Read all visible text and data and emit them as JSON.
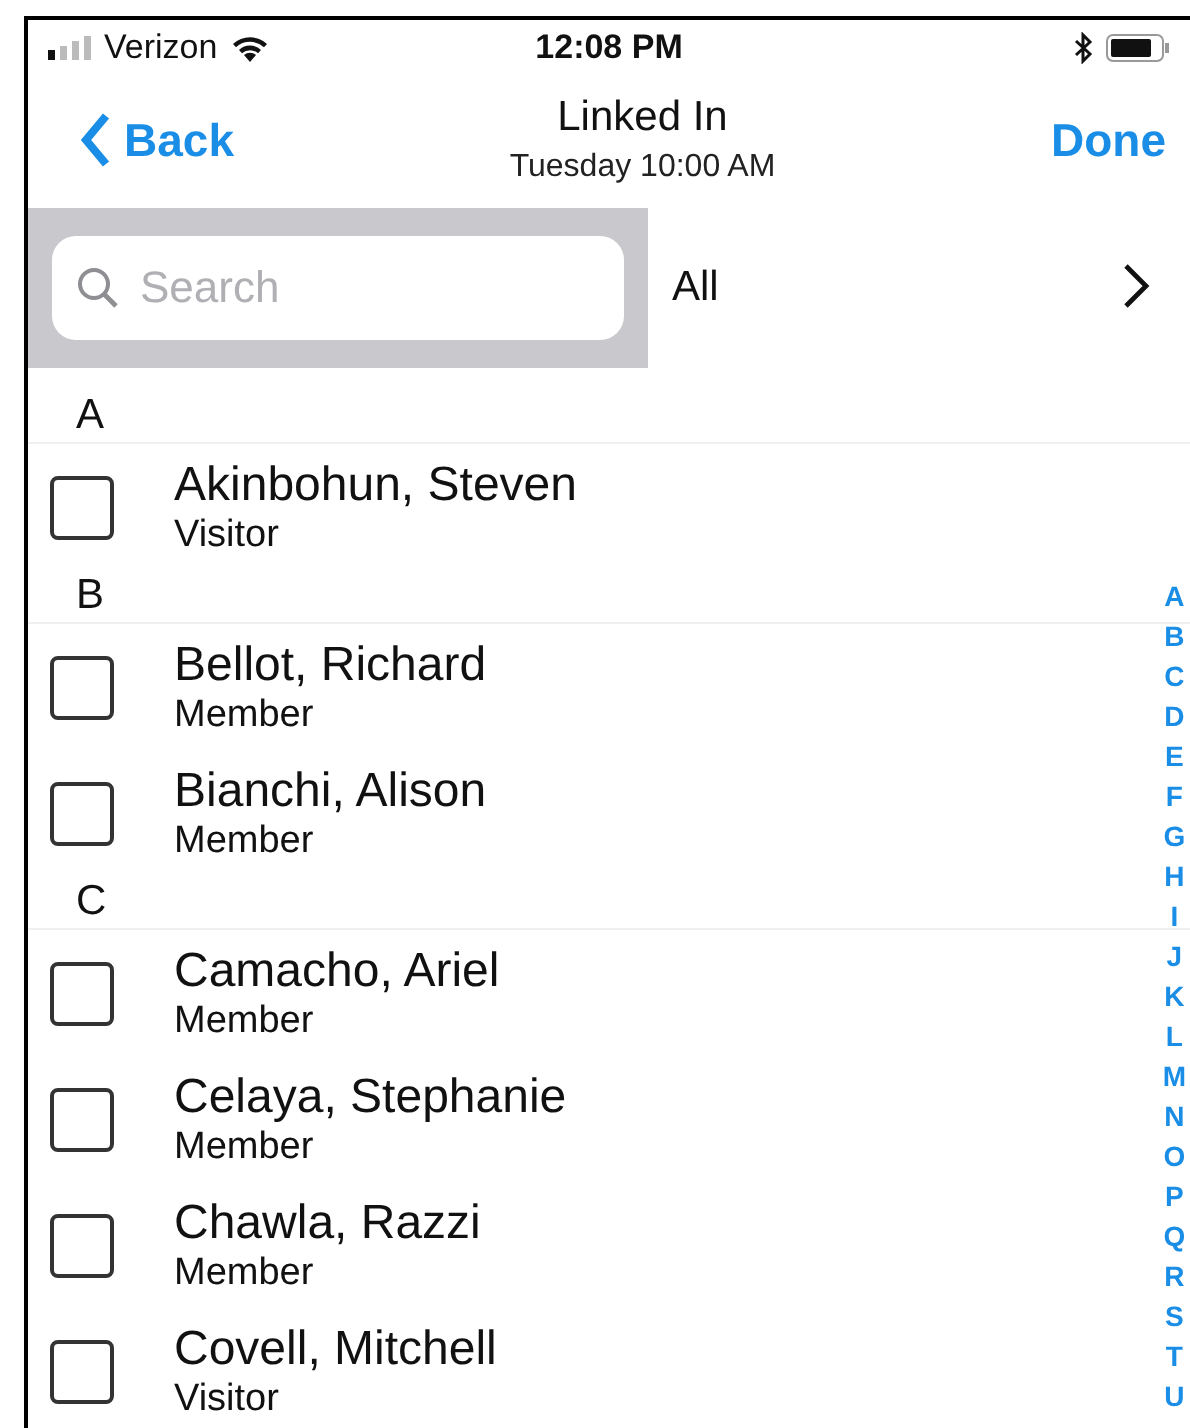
{
  "status_bar": {
    "carrier": "Verizon",
    "time": "12:08 PM"
  },
  "nav": {
    "back": "Back",
    "title": "Linked In",
    "subtitle": "Tuesday 10:00 AM",
    "done": "Done"
  },
  "search": {
    "placeholder": "Search"
  },
  "filter": {
    "label": "All"
  },
  "sections": [
    {
      "letter": "A",
      "people": [
        {
          "name": "Akinbohun, Steven",
          "role": "Visitor",
          "checked": false
        }
      ]
    },
    {
      "letter": "B",
      "people": [
        {
          "name": "Bellot, Richard",
          "role": "Member",
          "checked": false
        },
        {
          "name": "Bianchi, Alison",
          "role": "Member",
          "checked": false
        }
      ]
    },
    {
      "letter": "C",
      "people": [
        {
          "name": "Camacho, Ariel",
          "role": "Member",
          "checked": false
        },
        {
          "name": "Celaya, Stephanie",
          "role": "Member",
          "checked": false
        },
        {
          "name": "Chawla, Razzi",
          "role": "Member",
          "checked": false
        },
        {
          "name": "Covell, Mitchell",
          "role": "Visitor",
          "checked": false
        }
      ]
    }
  ],
  "index": [
    "A",
    "B",
    "C",
    "D",
    "E",
    "F",
    "G",
    "H",
    "I",
    "J",
    "K",
    "L",
    "M",
    "N",
    "O",
    "P",
    "Q",
    "R",
    "S",
    "T",
    "U"
  ]
}
